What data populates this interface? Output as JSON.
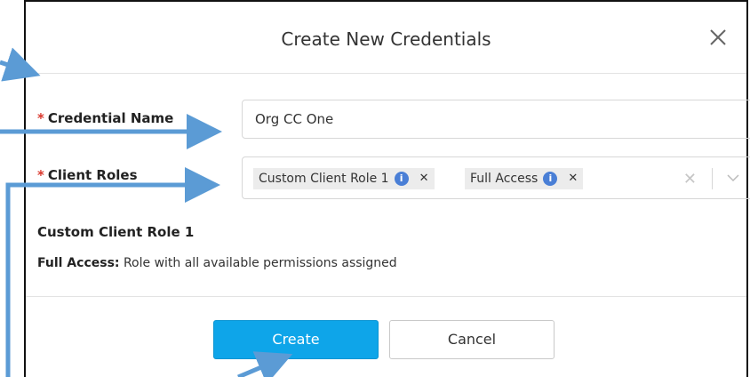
{
  "dialog": {
    "title": "Create New Credentials",
    "close_icon": "close-icon"
  },
  "form": {
    "credential_name": {
      "required_mark": "*",
      "label": "Credential Name",
      "value": "Org CC One"
    },
    "client_roles": {
      "required_mark": "*",
      "label": "Client Roles",
      "tags": [
        {
          "label": "Custom Client Role 1",
          "info_icon": "info-icon",
          "remove_icon": "close-icon"
        },
        {
          "label": "Full Access",
          "info_icon": "info-icon",
          "remove_icon": "close-icon"
        }
      ],
      "clear_icon": "close-icon",
      "dropdown_icon": "chevron-down-icon"
    }
  },
  "descriptions": {
    "title": "Custom Client Role 1",
    "full_access_label": "Full Access:",
    "full_access_text": " Role with all available permissions assigned"
  },
  "buttons": {
    "create": "Create",
    "cancel": "Cancel"
  },
  "colors": {
    "primary_button": "#0ea5e9",
    "annotation_arrow": "#5b9bd5",
    "required_star": "#d9362b",
    "info_icon": "#4a7fd6"
  }
}
